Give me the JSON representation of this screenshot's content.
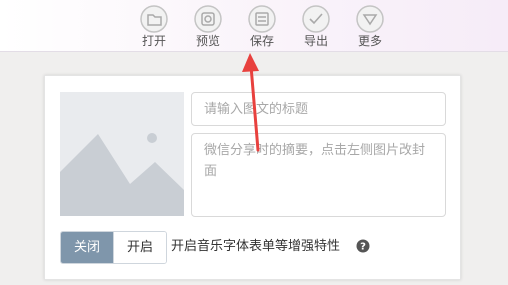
{
  "toolbar": {
    "items": [
      {
        "label": "打开",
        "icon": "folder-icon"
      },
      {
        "label": "预览",
        "icon": "preview-icon"
      },
      {
        "label": "保存",
        "icon": "save-icon"
      },
      {
        "label": "导出",
        "icon": "export-icon"
      },
      {
        "label": "更多",
        "icon": "more-icon"
      }
    ]
  },
  "editor": {
    "title_placeholder": "请输入图文的标题",
    "summary_placeholder": "微信分享时的摘要，点击左侧图片改封面",
    "toggle": {
      "off_label": "关闭",
      "on_label": "开启",
      "selected": "关闭"
    },
    "feature_label": "开启音乐字体表单等增强特性"
  },
  "colors": {
    "accent": "#7f96ab",
    "arrow": "#e8413e"
  }
}
